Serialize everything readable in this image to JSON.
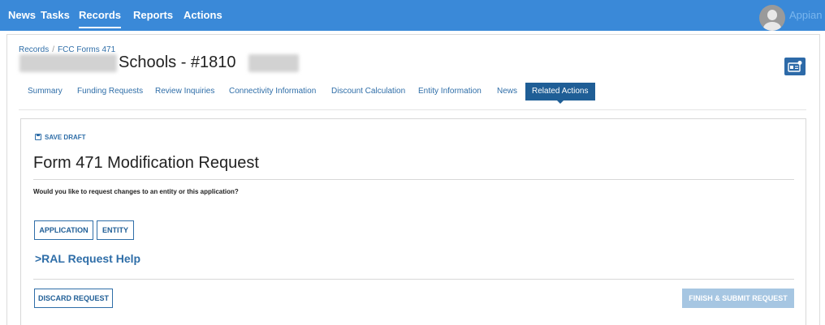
{
  "topnav": {
    "items": [
      {
        "label": "News"
      },
      {
        "label": "Tasks"
      },
      {
        "label": "Records",
        "active": true
      },
      {
        "label": "Reports"
      },
      {
        "label": "Actions"
      }
    ],
    "brand": "Appian",
    "color": "#3a89d8"
  },
  "breadcrumb": {
    "root": "Records",
    "separator": "/",
    "current": "FCC Forms 471"
  },
  "record": {
    "title": "Schools - #1810"
  },
  "tabs": [
    {
      "label": "Summary"
    },
    {
      "label": "Funding Requests"
    },
    {
      "label": "Review Inquiries"
    },
    {
      "label": "Connectivity Information"
    },
    {
      "label": "Discount Calculation"
    },
    {
      "label": "Entity Information"
    },
    {
      "label": "News"
    },
    {
      "label": "Related Actions",
      "active": true
    }
  ],
  "form": {
    "save_draft_label": "SAVE DRAFT",
    "title": "Form 471 Modification Request",
    "question": "Would you like to request changes to an entity or this application?",
    "application_button": "APPLICATION",
    "entity_button": "ENTITY",
    "help_link": ">RAL Request Help",
    "discard_button": "DISCARD REQUEST",
    "submit_button": "FINISH & SUBMIT REQUEST"
  },
  "colors": {
    "accent": "#2f6ea8",
    "active_tab": "#1f5e96",
    "disabled_button": "#a6c6e2"
  },
  "icons": {
    "save": "floppy-disk-icon",
    "record_id": "id-card-icon",
    "avatar": "user-avatar-icon"
  }
}
